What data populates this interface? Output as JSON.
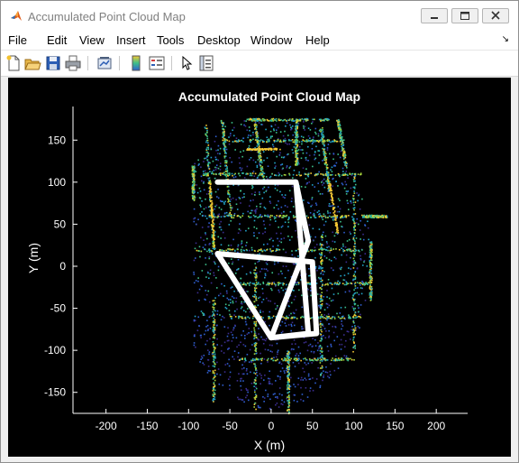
{
  "window": {
    "title": "Accumulated Point Cloud Map",
    "controls": [
      "minimize",
      "maximize",
      "close"
    ]
  },
  "menubar": {
    "items": [
      "File",
      "Edit",
      "View",
      "Insert",
      "Tools",
      "Desktop",
      "Window",
      "Help"
    ]
  },
  "toolbar": {
    "buttons": [
      {
        "icon": "new-figure-icon"
      },
      {
        "icon": "open-file-icon"
      },
      {
        "icon": "save-icon"
      },
      {
        "icon": "print-icon"
      },
      {
        "icon": "link-plot-icon"
      },
      {
        "icon": "insert-colorbar-icon"
      },
      {
        "icon": "insert-legend-icon"
      },
      {
        "icon": "edit-plot-arrow-icon"
      },
      {
        "icon": "property-inspector-icon"
      }
    ]
  },
  "chart_data": {
    "type": "scatter",
    "title": "Accumulated Point Cloud Map",
    "xlabel": "X (m)",
    "ylabel": "Y (m)",
    "xlim": [
      -240,
      238
    ],
    "ylim": [
      -175,
      190
    ],
    "xticks": [
      -200,
      -150,
      -100,
      -50,
      0,
      50,
      100,
      150,
      200
    ],
    "yticks": [
      -150,
      -100,
      -50,
      0,
      50,
      100,
      150
    ],
    "grid": false,
    "background": "#000000",
    "axis_color": "#ffffff",
    "colormap": [
      "#3b2d8f",
      "#2f5fd0",
      "#22a3c8",
      "#3cc08a",
      "#a7d33c",
      "#f5c834"
    ],
    "trajectory": {
      "color": "#ffffff",
      "x": [
        -65,
        30,
        45,
        0,
        -65,
        50,
        55,
        0,
        45,
        30
      ],
      "y": [
        100,
        100,
        30,
        -85,
        15,
        5,
        -80,
        -85,
        -80,
        100
      ]
    }
  }
}
